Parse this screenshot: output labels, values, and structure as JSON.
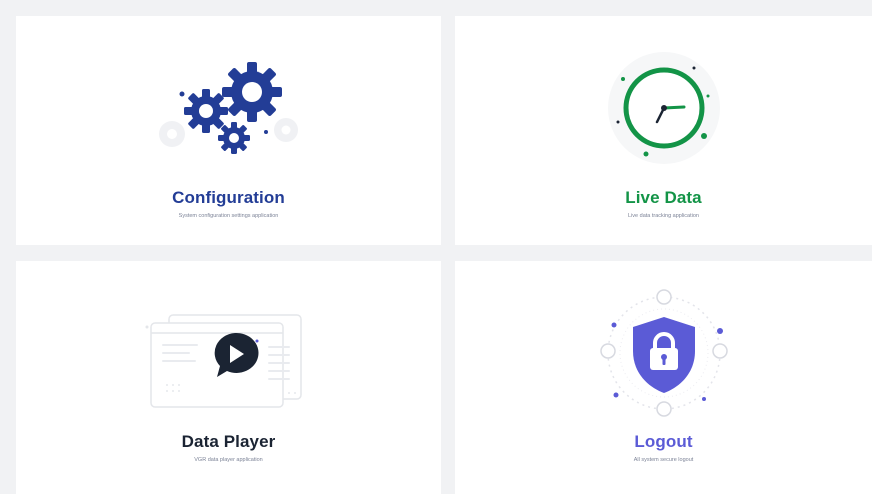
{
  "colors": {
    "background": "#f1f2f4",
    "tile": "#ffffff",
    "configuration_accent": "#233d96",
    "live_data_accent": "#139447",
    "data_player_accent": "#1b2433",
    "logout_accent": "#5b5bd6",
    "subtitle": "#7c8397"
  },
  "tiles": [
    {
      "id": "configuration",
      "title": "Configuration",
      "subtitle": "System configuration settings application",
      "icon": "gears-icon"
    },
    {
      "id": "live-data",
      "title": "Live Data",
      "subtitle": "Live data tracking application",
      "icon": "clock-icon"
    },
    {
      "id": "data-player",
      "title": "Data Player",
      "subtitle": "VGR data player application",
      "icon": "video-player-icon"
    },
    {
      "id": "logout",
      "title": "Logout",
      "subtitle": "All system secure logout",
      "icon": "shield-lock-icon"
    }
  ]
}
